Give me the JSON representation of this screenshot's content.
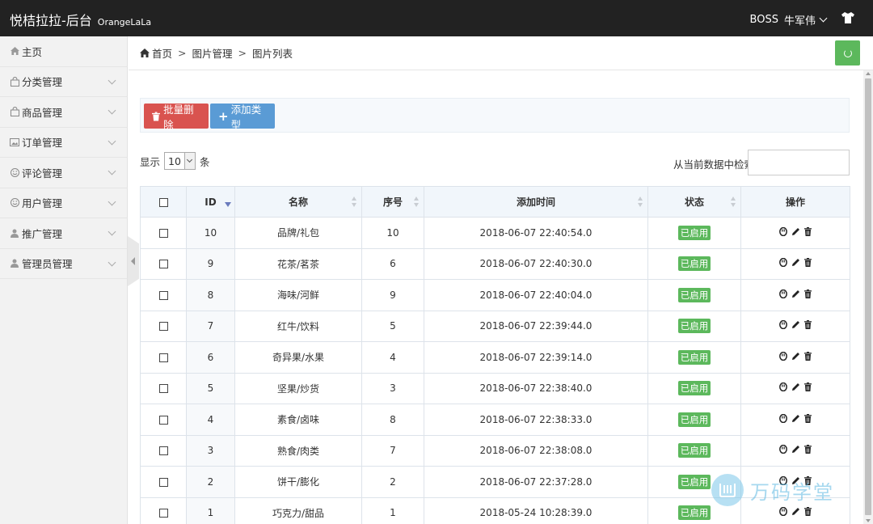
{
  "header": {
    "title": "悦桔拉拉-后台",
    "subtitle": "OrangeLaLa",
    "user_role": "BOSS",
    "user_name": "牛军伟"
  },
  "sidebar": {
    "items": [
      {
        "label": "主页",
        "icon": "home-icon",
        "has_arrow": false
      },
      {
        "label": "分类管理",
        "icon": "bag-icon",
        "has_arrow": true
      },
      {
        "label": "商品管理",
        "icon": "bag-icon",
        "has_arrow": true
      },
      {
        "label": "订单管理",
        "icon": "picture-icon",
        "has_arrow": true
      },
      {
        "label": "评论管理",
        "icon": "smile-icon",
        "has_arrow": true
      },
      {
        "label": "用户管理",
        "icon": "smile-icon",
        "has_arrow": true
      },
      {
        "label": "推广管理",
        "icon": "user-icon",
        "has_arrow": true
      },
      {
        "label": "管理员管理",
        "icon": "user-icon",
        "has_arrow": true
      }
    ]
  },
  "breadcrumb": {
    "home": "首页",
    "level1": "图片管理",
    "level2": "图片列表",
    "sep": ">"
  },
  "toolbar": {
    "batch_delete": "批量删除",
    "add_type": "添加类型"
  },
  "length": {
    "prefix": "显示",
    "value": "10",
    "suffix": "条"
  },
  "search": {
    "label": "从当前数据中检索:",
    "value": ""
  },
  "table": {
    "columns": [
      "",
      "ID",
      "名称",
      "序号",
      "添加时间",
      "状态",
      "操作"
    ],
    "rows": [
      {
        "id": "10",
        "name": "品牌/礼包",
        "order": "10",
        "time": "2018-06-07 22:40:54.0",
        "status": "已启用"
      },
      {
        "id": "9",
        "name": "花茶/茗茶",
        "order": "6",
        "time": "2018-06-07 22:40:30.0",
        "status": "已启用"
      },
      {
        "id": "8",
        "name": "海味/河鲜",
        "order": "9",
        "time": "2018-06-07 22:40:04.0",
        "status": "已启用"
      },
      {
        "id": "7",
        "name": "红牛/饮料",
        "order": "5",
        "time": "2018-06-07 22:39:44.0",
        "status": "已启用"
      },
      {
        "id": "6",
        "name": "奇异果/水果",
        "order": "4",
        "time": "2018-06-07 22:39:14.0",
        "status": "已启用"
      },
      {
        "id": "5",
        "name": "坚果/炒货",
        "order": "3",
        "time": "2018-06-07 22:38:40.0",
        "status": "已启用"
      },
      {
        "id": "4",
        "name": "素食/卤味",
        "order": "8",
        "time": "2018-06-07 22:38:33.0",
        "status": "已启用"
      },
      {
        "id": "3",
        "name": "熟食/肉类",
        "order": "7",
        "time": "2018-06-07 22:38:08.0",
        "status": "已启用"
      },
      {
        "id": "2",
        "name": "饼干/膨化",
        "order": "2",
        "time": "2018-06-07 22:37:28.0",
        "status": "已启用"
      },
      {
        "id": "1",
        "name": "巧克力/甜品",
        "order": "1",
        "time": "2018-05-24 10:28:39.0",
        "status": "已启用"
      }
    ]
  },
  "watermark": {
    "text": "万码学堂"
  },
  "colors": {
    "topbar": "#222222",
    "danger": "#d9534f",
    "primary": "#5a9bd5",
    "success": "#5cb85c"
  }
}
